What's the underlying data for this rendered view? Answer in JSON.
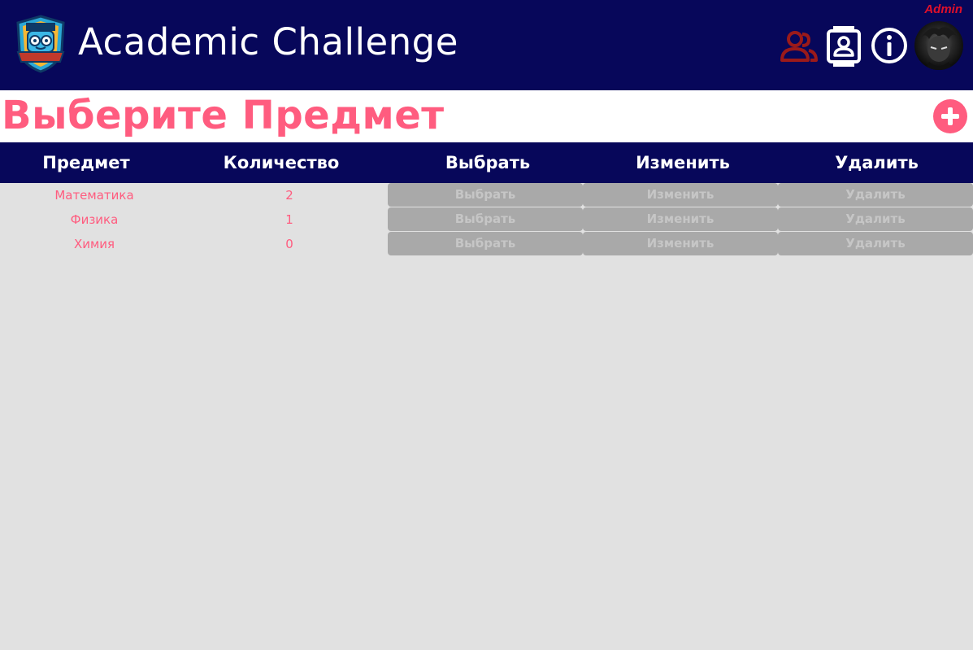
{
  "header": {
    "app_title": "Academic Challenge",
    "user_role": "Admin",
    "icons": [
      "logo-icon",
      "users-icon",
      "contact-card-icon",
      "info-icon",
      "avatar"
    ],
    "colors": {
      "navbar": "#07075a",
      "accent": "#ff5c7f",
      "users_icon": "#9b1a1a"
    }
  },
  "page": {
    "title": "Выберите Предмет",
    "add_icon": "plus-circle-icon"
  },
  "table": {
    "columns": [
      "Предмет",
      "Количество",
      "Выбрать",
      "Изменить",
      "Удалить"
    ],
    "rows": [
      {
        "subject": "Математика",
        "count": "2",
        "select": "Выбрать",
        "edit": "Изменить",
        "delete": "Удалить"
      },
      {
        "subject": "Физика",
        "count": "1",
        "select": "Выбрать",
        "edit": "Изменить",
        "delete": "Удалить"
      },
      {
        "subject": "Химия",
        "count": "0",
        "select": "Выбрать",
        "edit": "Изменить",
        "delete": "Удалить"
      }
    ]
  }
}
